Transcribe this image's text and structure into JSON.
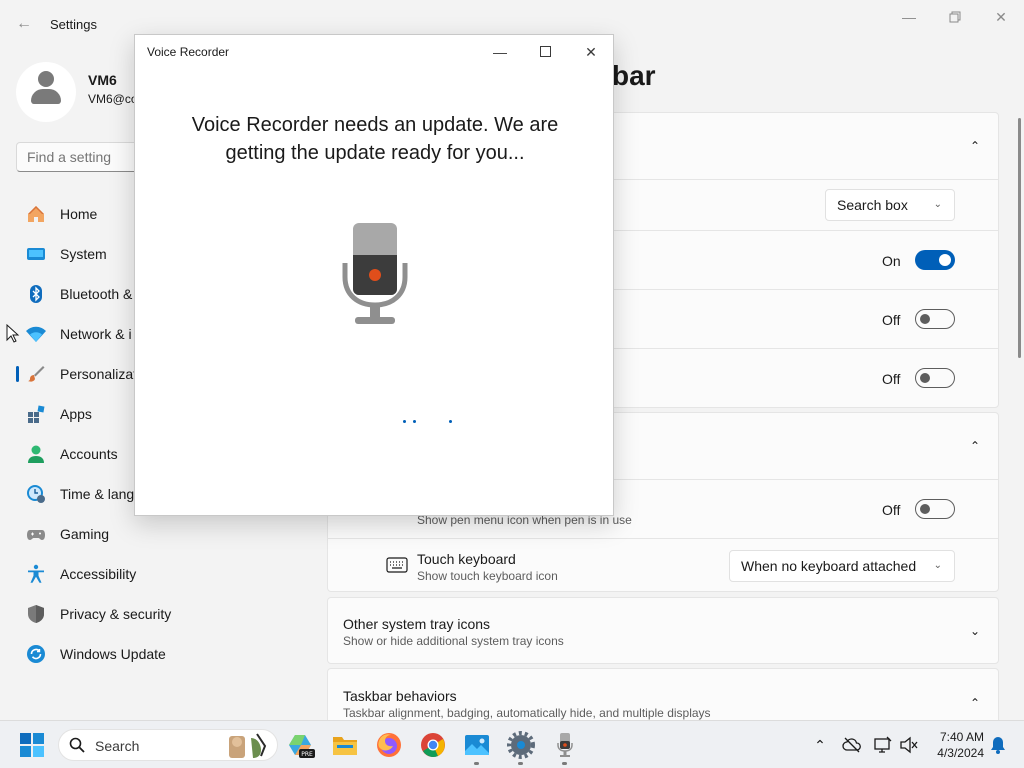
{
  "settings": {
    "app_title": "Settings",
    "profile": {
      "name": "VM6",
      "email": "VM6@co"
    },
    "find_placeholder": "Find a setting",
    "page_heading": "bar",
    "nav": [
      {
        "label": "Home",
        "icon": "home-icon"
      },
      {
        "label": "System",
        "icon": "system-icon"
      },
      {
        "label": "Bluetooth &",
        "icon": "bluetooth-icon"
      },
      {
        "label": "Network & i",
        "icon": "network-icon"
      },
      {
        "label": "Personalizat",
        "icon": "personalization-icon",
        "selected": true
      },
      {
        "label": "Apps",
        "icon": "apps-icon"
      },
      {
        "label": "Accounts",
        "icon": "accounts-icon"
      },
      {
        "label": "Time & lang",
        "icon": "time-language-icon"
      },
      {
        "label": "Gaming",
        "icon": "gaming-icon"
      },
      {
        "label": "Accessibility",
        "icon": "accessibility-icon"
      },
      {
        "label": "Privacy & security",
        "icon": "privacy-security-icon"
      },
      {
        "label": "Windows Update",
        "icon": "windows-update-icon"
      }
    ],
    "taskbar_items": {
      "search_dropdown_value": "Search box",
      "toggle1_state": "On",
      "toggle2_state": "Off",
      "toggle3_state": "Off"
    },
    "system_tray_icons": {
      "pen_menu_subtitle": "Show pen menu icon when pen is in use",
      "pen_menu_state": "Off",
      "touch_keyboard_title": "Touch keyboard",
      "touch_keyboard_subtitle": "Show touch keyboard icon",
      "touch_keyboard_value": "When no keyboard attached"
    },
    "other_tray": {
      "title": "Other system tray icons",
      "subtitle": "Show or hide additional system tray icons"
    },
    "behaviors": {
      "title": "Taskbar behaviors",
      "subtitle": "Taskbar alignment, badging, automatically hide, and multiple displays"
    }
  },
  "voice_recorder": {
    "title": "Voice Recorder",
    "message": "Voice Recorder needs an update. We are getting the update ready for you..."
  },
  "taskbar": {
    "search_label": "Search",
    "clock_time": "7:40 AM",
    "clock_date": "4/3/2024"
  },
  "colors": {
    "accent": "#005fb8",
    "mic_record": "#e04e1b"
  }
}
